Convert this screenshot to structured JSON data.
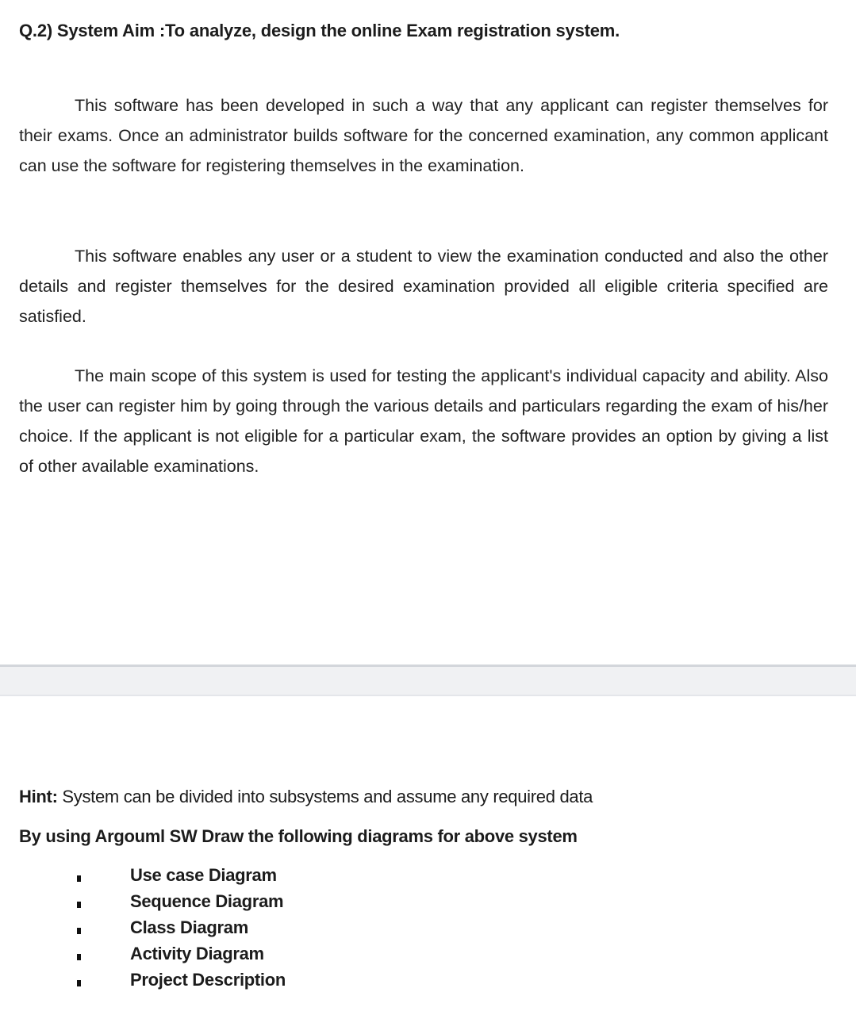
{
  "question": {
    "title": "Q.2)  System Aim :To analyze, design the online Exam registration system."
  },
  "paragraphs": [
    "This software has been developed in such a way that any applicant can register themselves for their exams. Once an administrator builds software for the concerned examination, any common applicant can use the software for registering themselves in the examination.",
    "This software enables any user or a student to view the examination conducted and also the other details and register themselves for the desired examination provided all eligible criteria specified are satisfied.",
    "The main scope of this system is used for testing the applicant's individual capacity and ability. Also the user can register him by going through the various details and particulars regarding the exam of his/her choice. If the applicant is not eligible for a particular exam, the software provides an option by giving a list of other available examinations."
  ],
  "hint": {
    "label": "Hint:",
    "text": " System can be divided into subsystems and assume any required data"
  },
  "instruction": "By using Argouml SW Draw the following diagrams  for above system",
  "deliverables": [
    "Use case Diagram",
    "Sequence Diagram",
    "Class Diagram",
    "Activity Diagram",
    "Project Description"
  ]
}
